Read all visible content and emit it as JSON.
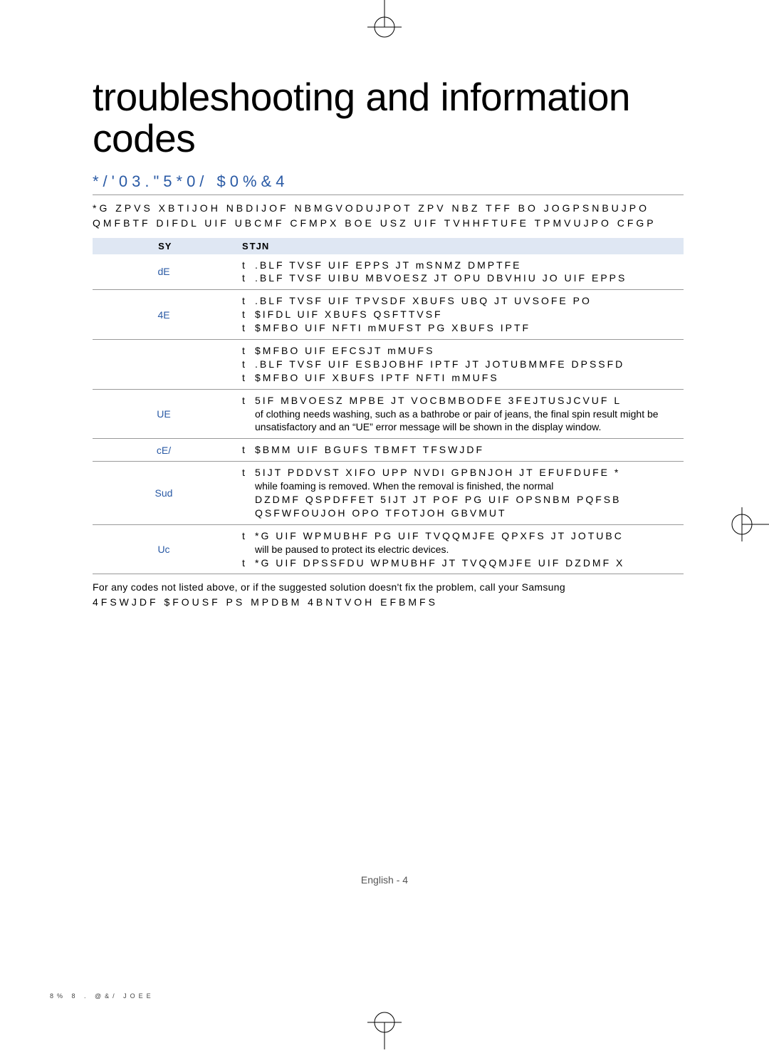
{
  "title": "troubleshooting and information codes",
  "section_title": "*/'03.\"5*0/ $0%&4",
  "intro_line1": "*G ZPVS XBTIJOH NBDIJOF NBMGVODUJPOT  ZPV NBZ TFF BO JOGPSNBUJPO",
  "intro_line2": "QMFBTF DIFDL UIF UBCMF CFMPX BOE USZ UIF TVHHFTUFE TPMVUJPO CFGP",
  "table": {
    "headers": [
      "\u0011 SY\u0011\u0011",
      "S\u0011TJN"
    ],
    "rows": [
      {
        "code": "dE",
        "items": [
          {
            "txt": ".BLF TVSF UIF EPPS JT mSNMZ DMPTFE",
            "spaced": true
          },
          {
            "txt": ".BLF TVSF UIBU MBVOESZ JT OPU DBVHIU JO UIF EPPS",
            "spaced": true
          }
        ]
      },
      {
        "code": "4E",
        "items": [
          {
            "txt": ".BLF TVSF UIF TPVSDF XBUFS UBQ JT UVSOFE PO",
            "spaced": true
          },
          {
            "txt": "$IFDL UIF XBUFS QSFTTVSF",
            "spaced": true
          },
          {
            "txt": "$MFBO UIF NFTI mMUFST PG XBUFS IPTF",
            "spaced": true
          }
        ]
      },
      {
        "code": "\u0011",
        "items": [
          {
            "txt": "$MFBO UIF EFCSJT mMUFS",
            "spaced": true
          },
          {
            "txt": ".BLF TVSF UIF ESBJOBHF IPTF JT JOTUBMMFE DPSSFD",
            "spaced": true
          },
          {
            "txt": "$MFBO UIF XBUFS IPTF NFTI mMUFS",
            "spaced": true
          }
        ]
      },
      {
        "code": "UE",
        "items": [
          {
            "txt": "5IF MBVOESZ MPBE JT VOCBMBODFE  3FEJTUSJCVUF L",
            "spaced": true
          },
          {
            "txt": "of clothing needs washing, such as a bathrobe or pair of jeans, the final spin result might be unsatisfactory and an “UE” error message will be shown in the display window.",
            "spaced": false,
            "nodot": true
          }
        ]
      },
      {
        "code": "cE/\u0011",
        "items": [
          {
            "txt": "$BMM UIF BGUFS TBMFT TFSWJDF",
            "spaced": true
          }
        ]
      },
      {
        "code": "Sud",
        "items": [
          {
            "txt": "5IJT PDDVST XIFO UPP NVDI GPBNJOH JT EFUFDUFE  *",
            "spaced": true
          },
          {
            "txt": "while foaming is removed. When the removal is finished, the normal",
            "spaced": false,
            "nodot": true
          },
          {
            "txt": "DZDMF QSPDFFET  5IJT JT POF PG UIF OPSNBM PQFSB",
            "spaced": true,
            "nodot": true
          },
          {
            "txt": "QSFWFOUJOH OPO TFOTJOH GBVMUT",
            "spaced": true,
            "nodot": true
          }
        ]
      },
      {
        "code": "Uc",
        "items": [
          {
            "txt": "*G UIF WPMUBHF PG UIF TVQQMJFE QPXFS JT JOTUBC",
            "spaced": true
          },
          {
            "txt": "will be paused to protect its electric devices.",
            "spaced": false,
            "nodot": true
          },
          {
            "txt": "*G UIF DPSSFDU WPMUBHF JT TVQQMJFE  UIF DZDMF X",
            "spaced": true
          }
        ]
      }
    ]
  },
  "outro_line1": "For any codes not listed above, or if the suggested solution doesn't fix the problem, call your Samsung",
  "outro_line2": "4FSWJDF $FOUSF PS MPDBM 4BNTVOH EFBMFS",
  "page_num": "English - 4\u0011",
  "footer_file": "8% 8    . @&/ JOEE"
}
